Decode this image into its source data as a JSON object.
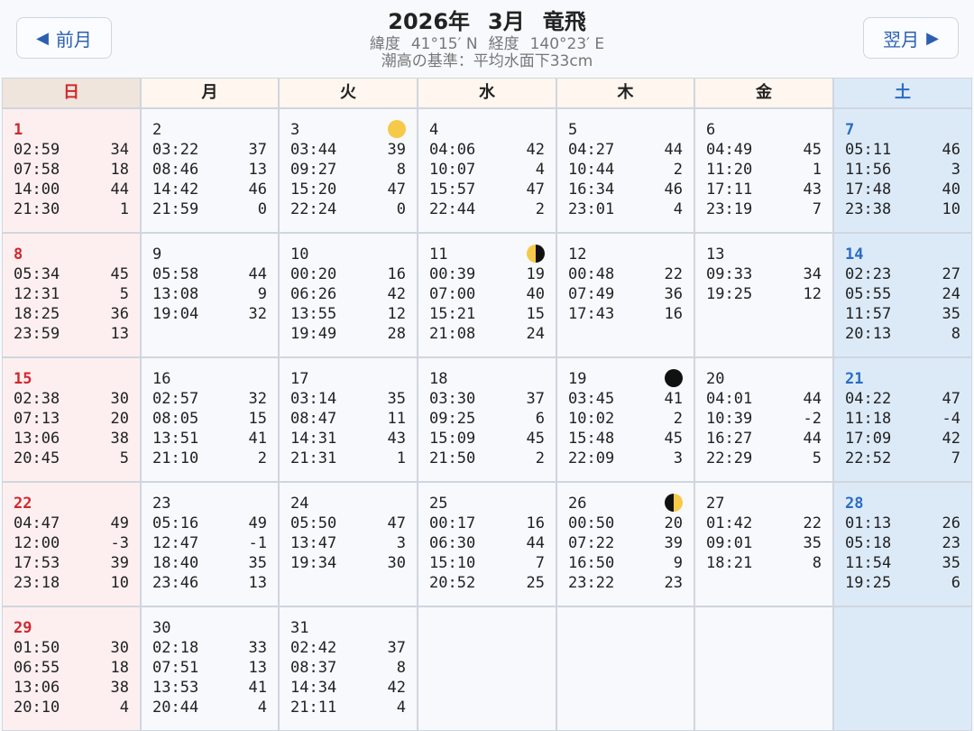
{
  "header": {
    "prev_label": "前月",
    "next_label": "翌月",
    "year": "2026年",
    "month": "3月",
    "place": "竜飛",
    "lat_label": "緯度",
    "lat_value": "41°15′ N",
    "lon_label": "経度",
    "lon_value": "140°23′ E",
    "datum": "潮高の基準：平均水面下33cm"
  },
  "weekdays": [
    "日",
    "月",
    "火",
    "水",
    "木",
    "金",
    "土"
  ],
  "colors": {
    "sunday": "#d0282d",
    "saturday": "#2b6cc4",
    "moon_yellow": "#f7c948",
    "moon_dark": "#111111"
  },
  "days": [
    {
      "day": "1",
      "moon": "",
      "tides": [
        [
          "02:59",
          "34"
        ],
        [
          "07:58",
          "18"
        ],
        [
          "14:00",
          "44"
        ],
        [
          "21:30",
          "1"
        ]
      ]
    },
    {
      "day": "2",
      "moon": "",
      "tides": [
        [
          "03:22",
          "37"
        ],
        [
          "08:46",
          "13"
        ],
        [
          "14:42",
          "46"
        ],
        [
          "21:59",
          "0"
        ]
      ]
    },
    {
      "day": "3",
      "moon": "full-moon-icon",
      "tides": [
        [
          "03:44",
          "39"
        ],
        [
          "09:27",
          "8"
        ],
        [
          "15:20",
          "47"
        ],
        [
          "22:24",
          "0"
        ]
      ]
    },
    {
      "day": "4",
      "moon": "",
      "tides": [
        [
          "04:06",
          "42"
        ],
        [
          "10:07",
          "4"
        ],
        [
          "15:57",
          "47"
        ],
        [
          "22:44",
          "2"
        ]
      ]
    },
    {
      "day": "5",
      "moon": "",
      "tides": [
        [
          "04:27",
          "44"
        ],
        [
          "10:44",
          "2"
        ],
        [
          "16:34",
          "46"
        ],
        [
          "23:01",
          "4"
        ]
      ]
    },
    {
      "day": "6",
      "moon": "",
      "tides": [
        [
          "04:49",
          "45"
        ],
        [
          "11:20",
          "1"
        ],
        [
          "17:11",
          "43"
        ],
        [
          "23:19",
          "7"
        ]
      ]
    },
    {
      "day": "7",
      "moon": "",
      "tides": [
        [
          "05:11",
          "46"
        ],
        [
          "11:56",
          "3"
        ],
        [
          "17:48",
          "40"
        ],
        [
          "23:38",
          "10"
        ]
      ]
    },
    {
      "day": "8",
      "moon": "",
      "tides": [
        [
          "05:34",
          "45"
        ],
        [
          "12:31",
          "5"
        ],
        [
          "18:25",
          "36"
        ],
        [
          "23:59",
          "13"
        ]
      ]
    },
    {
      "day": "9",
      "moon": "",
      "tides": [
        [
          "05:58",
          "44"
        ],
        [
          "13:08",
          "9"
        ],
        [
          "19:04",
          "32"
        ]
      ]
    },
    {
      "day": "10",
      "moon": "",
      "tides": [
        [
          "00:20",
          "16"
        ],
        [
          "06:26",
          "42"
        ],
        [
          "13:55",
          "12"
        ],
        [
          "19:49",
          "28"
        ]
      ]
    },
    {
      "day": "11",
      "moon": "last-quarter-moon-icon",
      "tides": [
        [
          "00:39",
          "19"
        ],
        [
          "07:00",
          "40"
        ],
        [
          "15:21",
          "15"
        ],
        [
          "21:08",
          "24"
        ]
      ]
    },
    {
      "day": "12",
      "moon": "",
      "tides": [
        [
          "00:48",
          "22"
        ],
        [
          "07:49",
          "36"
        ],
        [
          "17:43",
          "16"
        ]
      ]
    },
    {
      "day": "13",
      "moon": "",
      "tides": [
        [
          "09:33",
          "34"
        ],
        [
          "19:25",
          "12"
        ]
      ]
    },
    {
      "day": "14",
      "moon": "",
      "tides": [
        [
          "02:23",
          "27"
        ],
        [
          "05:55",
          "24"
        ],
        [
          "11:57",
          "35"
        ],
        [
          "20:13",
          "8"
        ]
      ]
    },
    {
      "day": "15",
      "moon": "",
      "tides": [
        [
          "02:38",
          "30"
        ],
        [
          "07:13",
          "20"
        ],
        [
          "13:06",
          "38"
        ],
        [
          "20:45",
          "5"
        ]
      ]
    },
    {
      "day": "16",
      "moon": "",
      "tides": [
        [
          "02:57",
          "32"
        ],
        [
          "08:05",
          "15"
        ],
        [
          "13:51",
          "41"
        ],
        [
          "21:10",
          "2"
        ]
      ]
    },
    {
      "day": "17",
      "moon": "",
      "tides": [
        [
          "03:14",
          "35"
        ],
        [
          "08:47",
          "11"
        ],
        [
          "14:31",
          "43"
        ],
        [
          "21:31",
          "1"
        ]
      ]
    },
    {
      "day": "18",
      "moon": "",
      "tides": [
        [
          "03:30",
          "37"
        ],
        [
          "09:25",
          "6"
        ],
        [
          "15:09",
          "45"
        ],
        [
          "21:50",
          "2"
        ]
      ]
    },
    {
      "day": "19",
      "moon": "new-moon-icon",
      "tides": [
        [
          "03:45",
          "41"
        ],
        [
          "10:02",
          "2"
        ],
        [
          "15:48",
          "45"
        ],
        [
          "22:09",
          "3"
        ]
      ]
    },
    {
      "day": "20",
      "moon": "",
      "tides": [
        [
          "04:01",
          "44"
        ],
        [
          "10:39",
          "-2"
        ],
        [
          "16:27",
          "44"
        ],
        [
          "22:29",
          "5"
        ]
      ]
    },
    {
      "day": "21",
      "moon": "",
      "tides": [
        [
          "04:22",
          "47"
        ],
        [
          "11:18",
          "-4"
        ],
        [
          "17:09",
          "42"
        ],
        [
          "22:52",
          "7"
        ]
      ]
    },
    {
      "day": "22",
      "moon": "",
      "tides": [
        [
          "04:47",
          "49"
        ],
        [
          "12:00",
          "-3"
        ],
        [
          "17:53",
          "39"
        ],
        [
          "23:18",
          "10"
        ]
      ]
    },
    {
      "day": "23",
      "moon": "",
      "tides": [
        [
          "05:16",
          "49"
        ],
        [
          "12:47",
          "-1"
        ],
        [
          "18:40",
          "35"
        ],
        [
          "23:46",
          "13"
        ]
      ]
    },
    {
      "day": "24",
      "moon": "",
      "tides": [
        [
          "05:50",
          "47"
        ],
        [
          "13:47",
          "3"
        ],
        [
          "19:34",
          "30"
        ]
      ]
    },
    {
      "day": "25",
      "moon": "",
      "tides": [
        [
          "00:17",
          "16"
        ],
        [
          "06:30",
          "44"
        ],
        [
          "15:10",
          "7"
        ],
        [
          "20:52",
          "25"
        ]
      ]
    },
    {
      "day": "26",
      "moon": "first-quarter-moon-icon",
      "tides": [
        [
          "00:50",
          "20"
        ],
        [
          "07:22",
          "39"
        ],
        [
          "16:50",
          "9"
        ],
        [
          "23:22",
          "23"
        ]
      ]
    },
    {
      "day": "27",
      "moon": "",
      "tides": [
        [
          "01:42",
          "22"
        ],
        [
          "09:01",
          "35"
        ],
        [
          "18:21",
          "8"
        ]
      ]
    },
    {
      "day": "28",
      "moon": "",
      "tides": [
        [
          "01:13",
          "26"
        ],
        [
          "05:18",
          "23"
        ],
        [
          "11:54",
          "35"
        ],
        [
          "19:25",
          "6"
        ]
      ]
    },
    {
      "day": "29",
      "moon": "",
      "tides": [
        [
          "01:50",
          "30"
        ],
        [
          "06:55",
          "18"
        ],
        [
          "13:06",
          "38"
        ],
        [
          "20:10",
          "4"
        ]
      ]
    },
    {
      "day": "30",
      "moon": "",
      "tides": [
        [
          "02:18",
          "33"
        ],
        [
          "07:51",
          "13"
        ],
        [
          "13:53",
          "41"
        ],
        [
          "20:44",
          "4"
        ]
      ]
    },
    {
      "day": "31",
      "moon": "",
      "tides": [
        [
          "02:42",
          "37"
        ],
        [
          "08:37",
          "8"
        ],
        [
          "14:34",
          "42"
        ],
        [
          "21:11",
          "4"
        ]
      ]
    }
  ]
}
